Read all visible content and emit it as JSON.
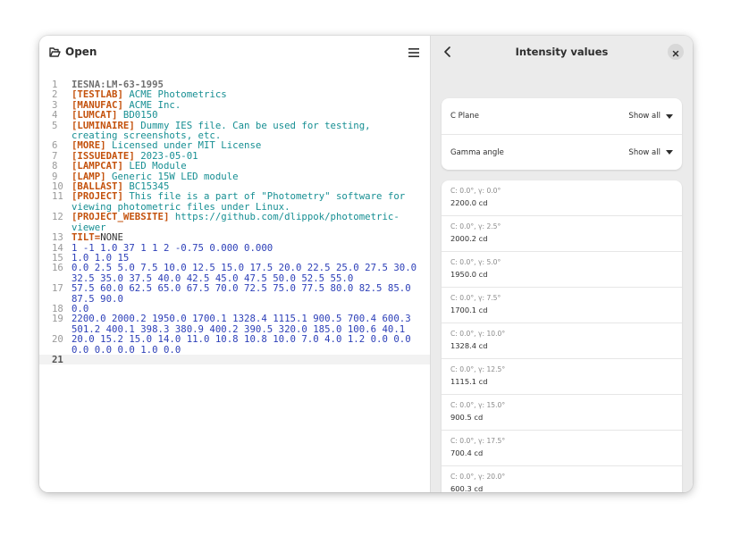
{
  "header": {
    "open_label": "Open"
  },
  "code_lines": [
    {
      "n": "1",
      "parts": [
        {
          "t": "IESNA:LM-63-1995",
          "c": "hdr"
        }
      ]
    },
    {
      "n": "2",
      "parts": [
        {
          "t": "[TESTLAB]",
          "c": "kw"
        },
        {
          "t": " ACME Photometrics",
          "c": "val"
        }
      ]
    },
    {
      "n": "3",
      "parts": [
        {
          "t": "[MANUFAC]",
          "c": "kw"
        },
        {
          "t": " ACME Inc.",
          "c": "val"
        }
      ]
    },
    {
      "n": "4",
      "parts": [
        {
          "t": "[LUMCAT]",
          "c": "kw"
        },
        {
          "t": " BD0150",
          "c": "val"
        }
      ]
    },
    {
      "n": "5",
      "parts": [
        {
          "t": "[LUMINAIRE]",
          "c": "kw"
        },
        {
          "t": " Dummy IES file. Can be used for testing, creating screenshots, etc.",
          "c": "val"
        }
      ]
    },
    {
      "n": "6",
      "parts": [
        {
          "t": "[MORE]",
          "c": "kw"
        },
        {
          "t": " Licensed under MIT License",
          "c": "val"
        }
      ]
    },
    {
      "n": "7",
      "parts": [
        {
          "t": "[ISSUEDATE]",
          "c": "kw"
        },
        {
          "t": " 2023-05-01",
          "c": "val"
        }
      ]
    },
    {
      "n": "8",
      "parts": [
        {
          "t": "[LAMPCAT]",
          "c": "kw"
        },
        {
          "t": " LED Module",
          "c": "val"
        }
      ]
    },
    {
      "n": "9",
      "parts": [
        {
          "t": "[LAMP]",
          "c": "kw"
        },
        {
          "t": " Generic 15W LED module",
          "c": "val"
        }
      ]
    },
    {
      "n": "10",
      "parts": [
        {
          "t": "[BALLAST]",
          "c": "kw"
        },
        {
          "t": " BC15345",
          "c": "val"
        }
      ]
    },
    {
      "n": "11",
      "parts": [
        {
          "t": "[PROJECT]",
          "c": "kw"
        },
        {
          "t": " This file is a part of \"Photometry\" software for viewing photometric files under Linux.",
          "c": "val"
        }
      ]
    },
    {
      "n": "12",
      "parts": [
        {
          "t": "[PROJECT_WEBSITE]",
          "c": "kw"
        },
        {
          "t": " https://github.com/dlippok/photometric-viewer",
          "c": "val"
        }
      ]
    },
    {
      "n": "13",
      "parts": [
        {
          "t": "TILT=",
          "c": "kw"
        },
        {
          "t": "NONE",
          "c": "tiltval"
        }
      ]
    },
    {
      "n": "14",
      "parts": [
        {
          "t": "1 -1 1.0 37 1 1 2 -0.75 0.000 0.000",
          "c": "plain"
        }
      ]
    },
    {
      "n": "15",
      "parts": [
        {
          "t": "1.0 1.0 15",
          "c": "plain"
        }
      ]
    },
    {
      "n": "16",
      "parts": [
        {
          "t": "0.0 2.5 5.0 7.5 10.0 12.5 15.0 17.5 20.0 22.5 25.0 27.5 30.0 32.5 35.0 37.5 40.0 42.5 45.0 47.5 50.0 52.5 55.0",
          "c": "plain"
        }
      ]
    },
    {
      "n": "17",
      "parts": [
        {
          "t": "57.5 60.0 62.5 65.0 67.5 70.0 72.5 75.0 77.5 80.0 82.5 85.0 87.5 90.0",
          "c": "plain"
        }
      ]
    },
    {
      "n": "18",
      "parts": [
        {
          "t": "0.0",
          "c": "plain"
        }
      ]
    },
    {
      "n": "19",
      "parts": [
        {
          "t": "2200.0 2000.2 1950.0 1700.1 1328.4 1115.1 900.5 700.4 600.3 501.2 400.1 398.3 380.9 400.2 390.5 320.0 185.0 100.6 40.1",
          "c": "plain"
        }
      ]
    },
    {
      "n": "20",
      "parts": [
        {
          "t": "20.0 15.2 15.0 14.0 11.0 10.8 10.8 10.0 7.0 4.0 1.2 0.0 0.0 0.0 0.0 0.0 1.0 0.0",
          "c": "plain"
        }
      ]
    },
    {
      "n": "21",
      "parts": [
        {
          "t": "",
          "c": "plain"
        }
      ],
      "current": true
    }
  ],
  "panel": {
    "title": "Intensity values",
    "filters": [
      {
        "label": "C Plane",
        "value": "Show all"
      },
      {
        "label": "Gamma angle",
        "value": "Show all"
      }
    ],
    "values": [
      {
        "angle": "C: 0.0°, γ: 0.0°",
        "value": "2200.0 cd"
      },
      {
        "angle": "C: 0.0°, γ: 2.5°",
        "value": "2000.2 cd"
      },
      {
        "angle": "C: 0.0°, γ: 5.0°",
        "value": "1950.0 cd"
      },
      {
        "angle": "C: 0.0°, γ: 7.5°",
        "value": "1700.1 cd"
      },
      {
        "angle": "C: 0.0°, γ: 10.0°",
        "value": "1328.4 cd"
      },
      {
        "angle": "C: 0.0°, γ: 12.5°",
        "value": "1115.1 cd"
      },
      {
        "angle": "C: 0.0°, γ: 15.0°",
        "value": "900.5 cd"
      },
      {
        "angle": "C: 0.0°, γ: 17.5°",
        "value": "700.4 cd"
      },
      {
        "angle": "C: 0.0°, γ: 20.0°",
        "value": "600.3 cd"
      }
    ]
  }
}
